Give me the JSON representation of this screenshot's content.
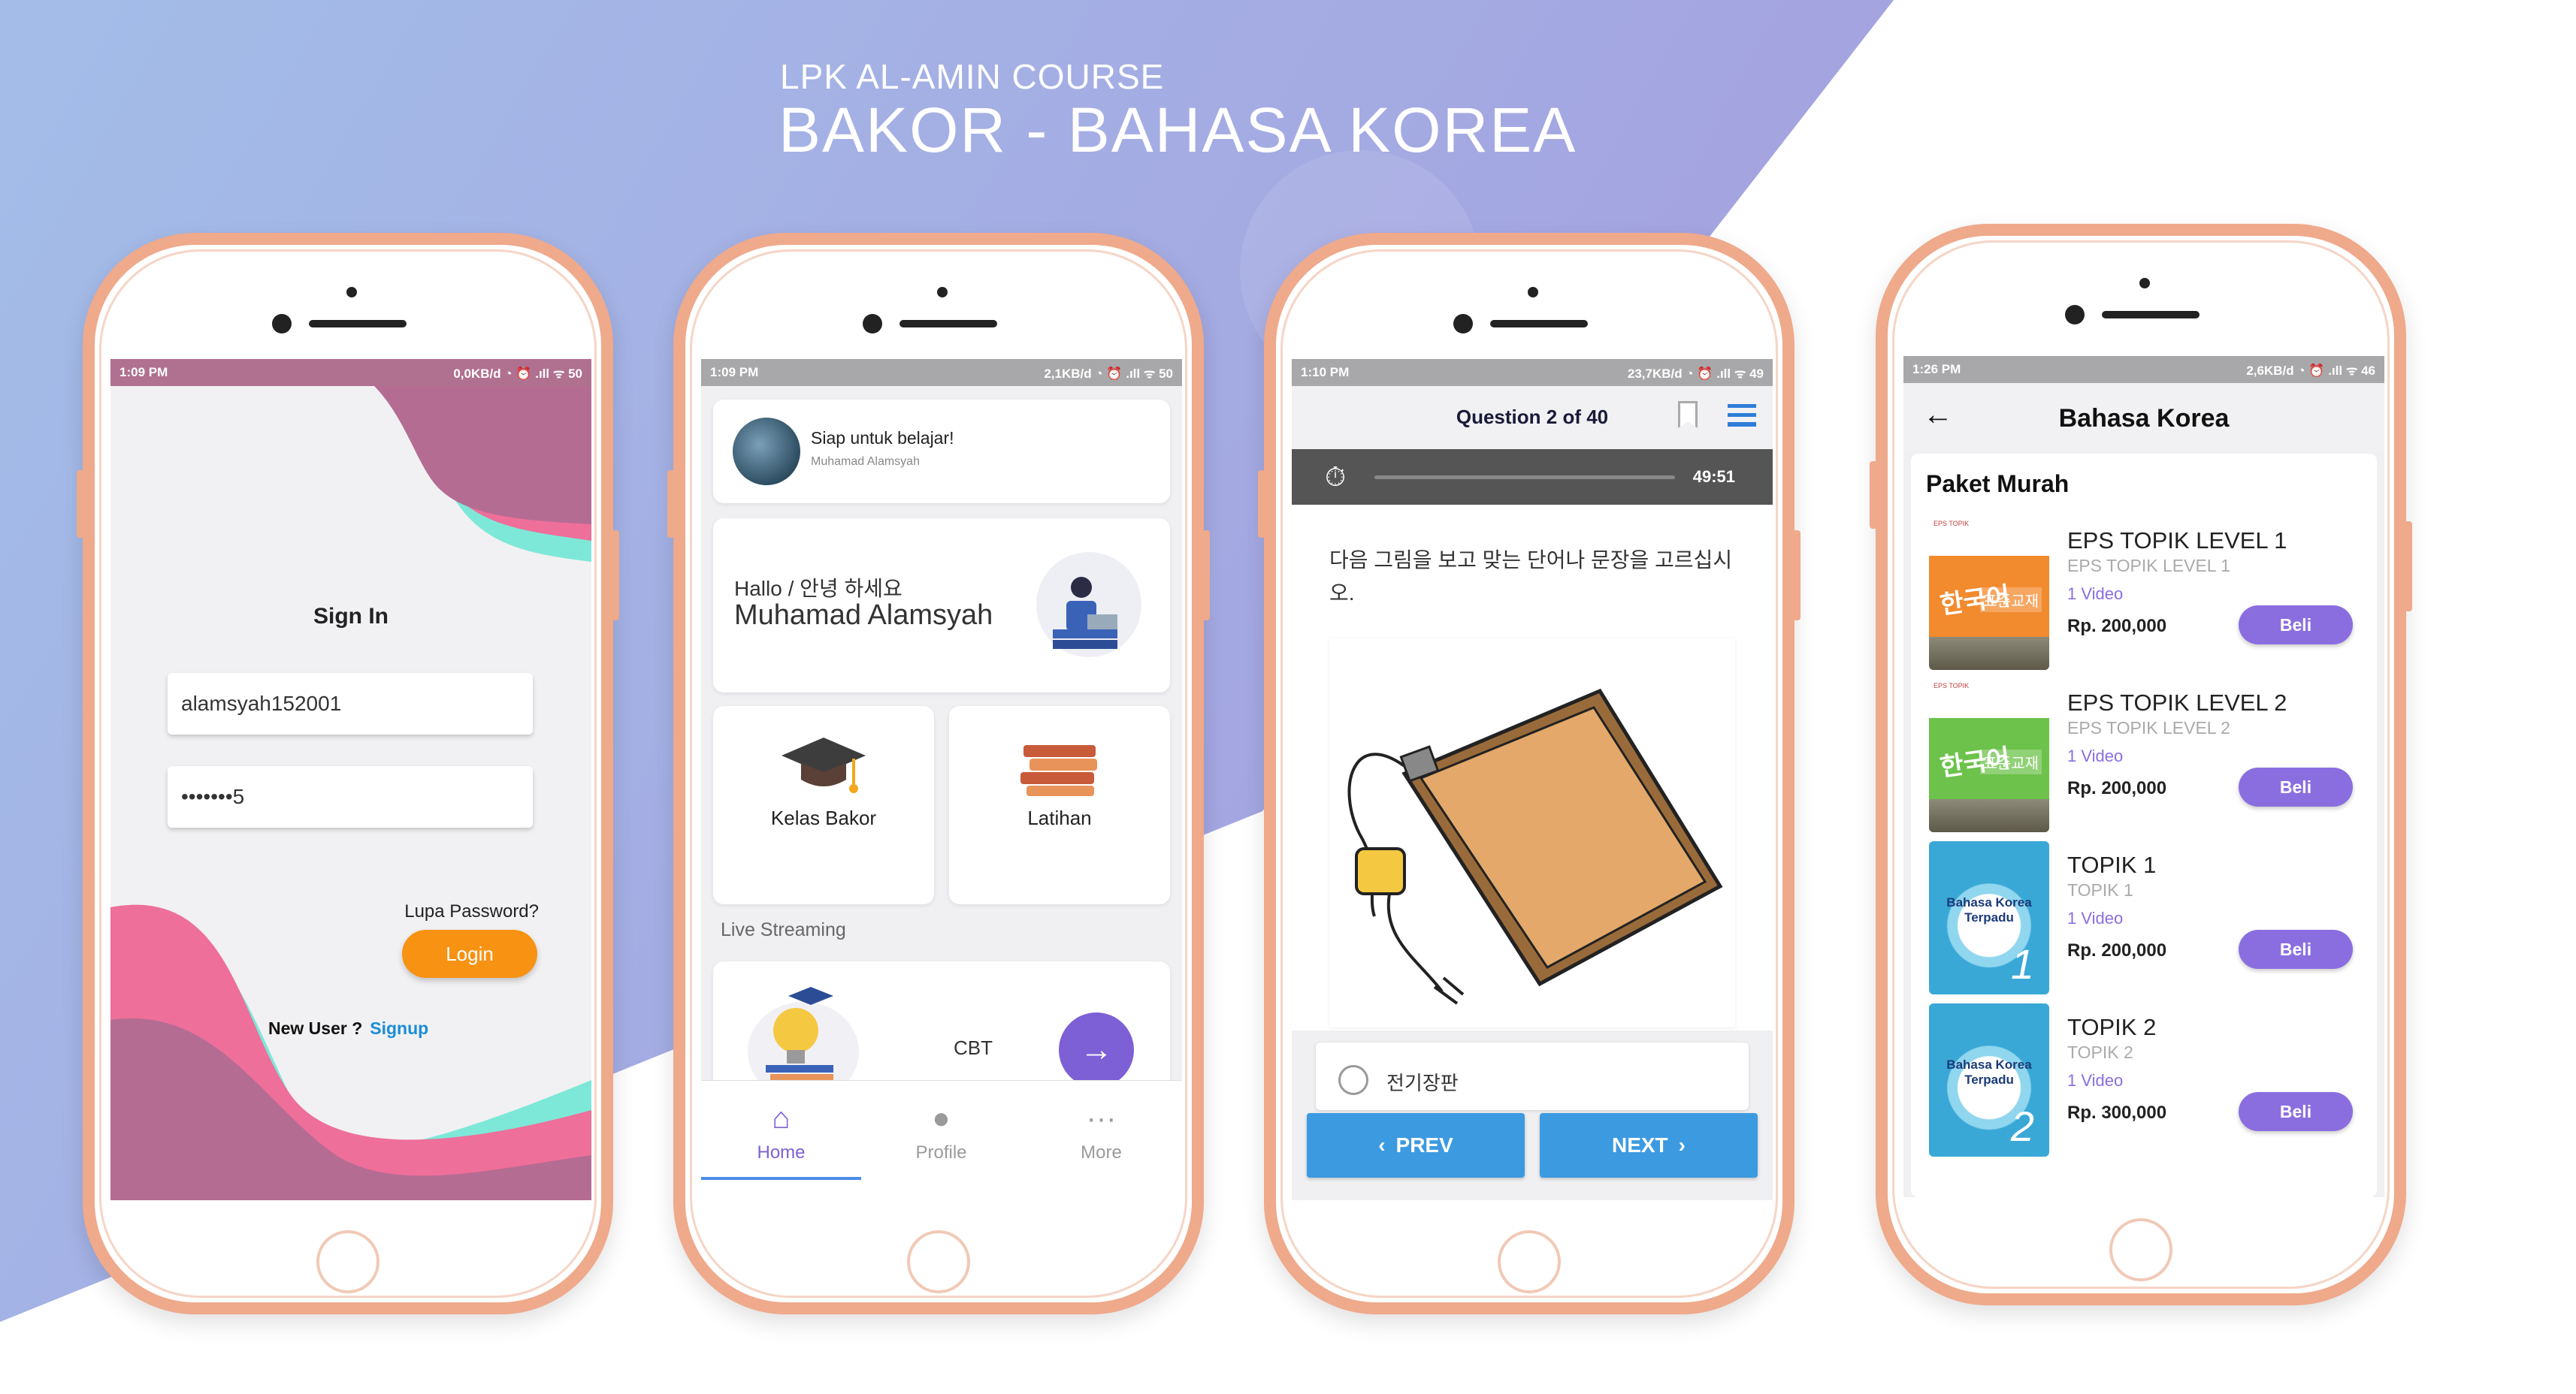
{
  "header": {
    "subtitle": "LPK AL-AMIN COURSE",
    "title": "BAKOR - BAHASA KOREA"
  },
  "colors": {
    "accent_purple": "#7d5fd6",
    "login_orange": "#f79212",
    "nav_blue": "#3c9ae0",
    "phone_frame": "#efa98b"
  },
  "screen_login": {
    "status_time": "1:09 PM",
    "status_right": "0,0KB/d ◔ ⏰ .ıll ᯤ 50",
    "title": "Sign In",
    "username_value": "alamsyah152001",
    "password_value": "•••••••5",
    "forgot_label": "Lupa Password?",
    "login_label": "Login",
    "new_user_label": "New User ?",
    "signup_label": "Signup"
  },
  "screen_home": {
    "status_time": "1:09 PM",
    "status_right": "2,1KB/d ◔ ⏰ .ıll ᯤ 50",
    "greeting": "Siap untuk belajar!",
    "user_small": "Muhamad Alamsyah",
    "hallo": "Hallo / 안녕 하세요",
    "name": "Muhamad Alamsyah",
    "tile_kelas": "Kelas Bakor",
    "tile_latihan": "Latihan",
    "section_live": "Live Streaming",
    "cbt_label": "CBT",
    "nav": [
      {
        "label": "Home",
        "icon": "home-icon"
      },
      {
        "label": "Profile",
        "icon": "person-icon"
      },
      {
        "label": "More",
        "icon": "more-icon"
      }
    ]
  },
  "screen_question": {
    "status_time": "1:10 PM",
    "status_right": "23,7KB/d ◔ ⏰ .ıll ᯤ 49",
    "title": "Question 2 of 40",
    "timer": "49:51",
    "question_text": "다음 그림을 보고  맞는 단어나 문장을 고르십시오.",
    "option_1": "전기장판",
    "prev_label": "PREV",
    "next_label": "NEXT"
  },
  "screen_store": {
    "status_time": "1:26 PM",
    "status_right": "2,6KB/d ◔ ⏰ .ıll ᯤ 46",
    "title": "Bahasa Korea",
    "section": "Paket Murah",
    "products": [
      {
        "name": "EPS TOPIK LEVEL 1",
        "sub": "EPS TOPIK LEVEL 1",
        "video": "1 Video",
        "price": "Rp. 200,000",
        "buy": "Beli",
        "cover": "EPS TOPIK",
        "cover_kor": "한국어",
        "cover_tag": "표준교재"
      },
      {
        "name": "EPS TOPIK LEVEL 2",
        "sub": "EPS TOPIK LEVEL 2",
        "video": "1 Video",
        "price": "Rp. 200,000",
        "buy": "Beli",
        "cover": "EPS TOPIK",
        "cover_kor": "한국어",
        "cover_tag": "표준교재"
      },
      {
        "name": "TOPIK 1",
        "sub": "TOPIK 1",
        "video": "1 Video",
        "price": "Rp. 200,000",
        "buy": "Beli",
        "cover_title": "Bahasa Korea Terpadu",
        "cover_num": "1"
      },
      {
        "name": "TOPIK 2",
        "sub": "TOPIK 2",
        "video": "1 Video",
        "price": "Rp. 300,000",
        "buy": "Beli",
        "cover_title": "Bahasa Korea Terpadu",
        "cover_num": "2"
      }
    ]
  }
}
